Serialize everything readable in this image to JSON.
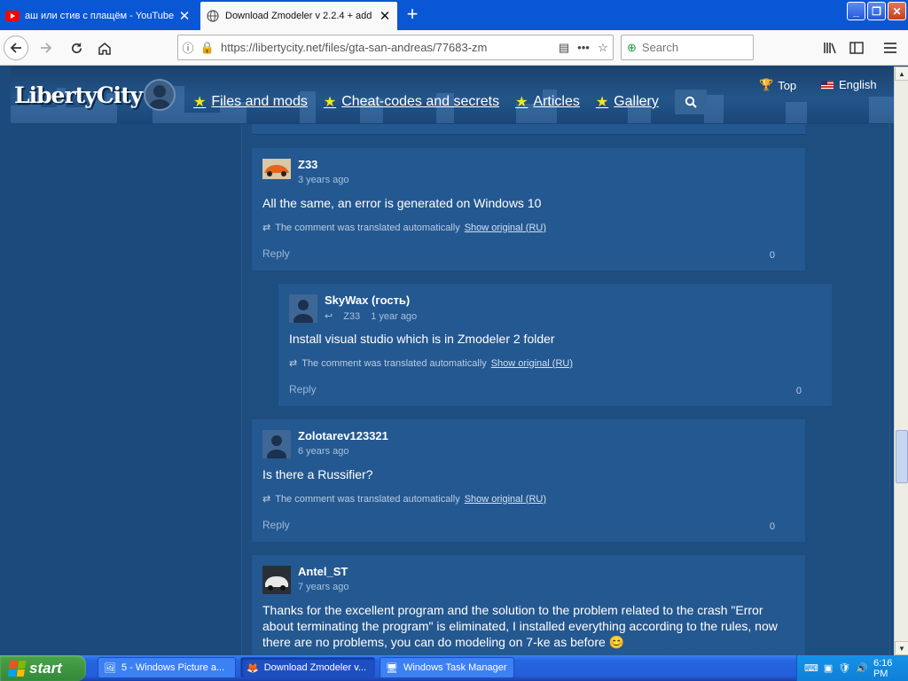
{
  "browser": {
    "tabs": [
      {
        "title": "аш или стив с плащём - YouTube",
        "icon": "youtube-icon"
      },
      {
        "title": "Download Zmodeler v 2.2.4 + add",
        "icon": "globe-icon"
      }
    ],
    "url": "https://libertycity.net/files/gta-san-andreas/77683-zm",
    "search_placeholder": "Search"
  },
  "site": {
    "logo": "LibertyCity",
    "menu": [
      "Files and mods",
      "Cheat-codes and secrets",
      "Articles",
      "Gallery"
    ],
    "top_label": "Top",
    "language": "English"
  },
  "comments": [
    {
      "user": "Z33",
      "time": "3 years ago",
      "reply_to": "",
      "body": "All the same, an error is generated on Windows 10",
      "translated_note": "The comment was translated automatically",
      "show_original": "Show original (RU)",
      "reply": "Reply",
      "count": "0"
    },
    {
      "user": "SkyWax (гость)",
      "time": "1 year ago",
      "reply_to": "Z33",
      "body": "Install visual studio which is in Zmodeler 2 folder",
      "translated_note": "The comment was translated automatically",
      "show_original": "Show original (RU)",
      "reply": "Reply",
      "count": "0"
    },
    {
      "user": "Zolotarev123321",
      "time": "6 years ago",
      "reply_to": "",
      "body": "Is there a Russifier?",
      "translated_note": "The comment was translated automatically",
      "show_original": "Show original (RU)",
      "reply": "Reply",
      "count": "0"
    },
    {
      "user": "Antel_ST",
      "time": "7 years ago",
      "reply_to": "",
      "body": "Thanks for the excellent program and the solution to the problem related to the crash \"Error about terminating the program\" is eliminated, I installed everything according to the rules, now there are no problems, you can do modeling on 7-ke as before"
    }
  ],
  "taskbar": {
    "start": "start",
    "tasks": [
      "5 - Windows Picture a...",
      "Download Zmodeler v...",
      "Windows Task Manager"
    ],
    "clock": "6:16 PM"
  }
}
